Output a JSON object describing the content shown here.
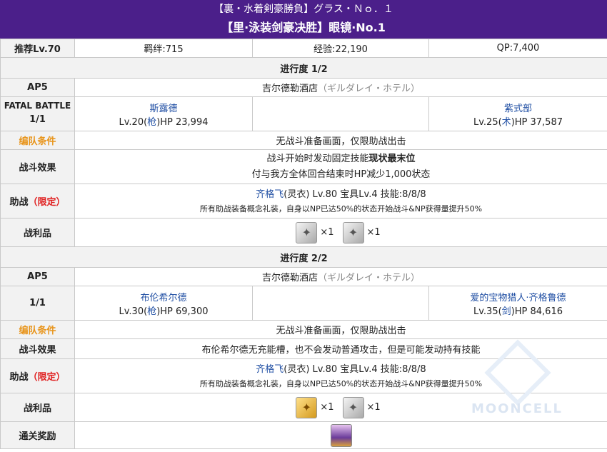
{
  "header": {
    "jp_title": "【裏・水着剣豪勝負】グラス・Ｎｏ．１",
    "cn_title": "【里·泳装剑豪决胜】眼镜·No.1"
  },
  "summary": {
    "level": "推荐Lv.70",
    "bond": "羁绊:715",
    "exp": "经验:22,190",
    "qp": "QP:7,400"
  },
  "stages": [
    {
      "title": "进行度 1/2",
      "ap": "AP5",
      "location": "吉尔德勒酒店",
      "location_jp": "（ギルダレイ・ホテル）",
      "battle_label_1": "FATAL BATTLE",
      "battle_label_2": "1/1",
      "enemy_left": {
        "name": "斯露德",
        "stats_a": "Lv.20(",
        "cls": "枪",
        "stats_b": ")HP 23,994"
      },
      "enemy_right": {
        "name": "紫式部",
        "stats_a": "Lv.25(",
        "cls": "术",
        "stats_b": ")HP 37,587"
      },
      "formation_label": "编队条件",
      "formation": "无战斗准备画面，仅限助战出击",
      "effect_label": "战斗效果",
      "effect_line1_a": "战斗开始时发动固定技能",
      "effect_line1_b": "现状最末位",
      "effect_line2": "付与我方全体回合结束时HP减少1,000状态",
      "support_label_a": "助战",
      "support_label_b": "（限定）",
      "support_name": "齐格飞",
      "support_rest": "(灵衣) Lv.80 宝具Lv.4 技能:8/8/8",
      "support_note": "所有助战装备概念礼装，自身以NP已达50%的状态开始战斗&NP获得量提升50%",
      "drops_label": "战利品",
      "drops": [
        {
          "icon": "silver-material-icon",
          "qty": "×1"
        },
        {
          "icon": "silver-material-icon",
          "qty": "×1"
        }
      ]
    },
    {
      "title": "进行度 2/2",
      "ap": "AP5",
      "location": "吉尔德勒酒店",
      "location_jp": "（ギルダレイ・ホテル）",
      "battle_label_2": "1/1",
      "enemy_left": {
        "name": "布伦希尔德",
        "stats_a": "Lv.30(",
        "cls": "枪",
        "stats_b": ")HP 69,300"
      },
      "enemy_right": {
        "name": "爱的宝物猎人·齐格鲁德",
        "stats_a": "Lv.35(",
        "cls": "剑",
        "stats_b": ")HP 84,616"
      },
      "formation_label": "编队条件",
      "formation": "无战斗准备画面，仅限助战出击",
      "effect_label": "战斗效果",
      "effect_text": "布伦希尔德无充能槽，也不会发动普通攻击，但是可能发动持有技能",
      "support_label_a": "助战",
      "support_label_b": "（限定）",
      "support_name": "齐格飞",
      "support_rest": "(灵衣) Lv.80 宝具Lv.4 技能:8/8/8",
      "support_note": "所有助战装备概念礼装，自身以NP已达50%的状态开始战斗&NP获得量提升50%",
      "drops_label": "战利品",
      "drops": [
        {
          "icon": "gold-material-icon",
          "qty": "×1"
        },
        {
          "icon": "silver-material-icon",
          "qty": "×1"
        }
      ],
      "clear_reward_label": "通关奖励",
      "clear_reward_icon": "servant-portrait-icon"
    }
  ],
  "watermark": "MOONCELL",
  "colors": {
    "header_bg": "#4b1f8a",
    "link_blue": "#1f4ea3",
    "label_orange": "#e8941a",
    "limited_red": "#e02020"
  }
}
